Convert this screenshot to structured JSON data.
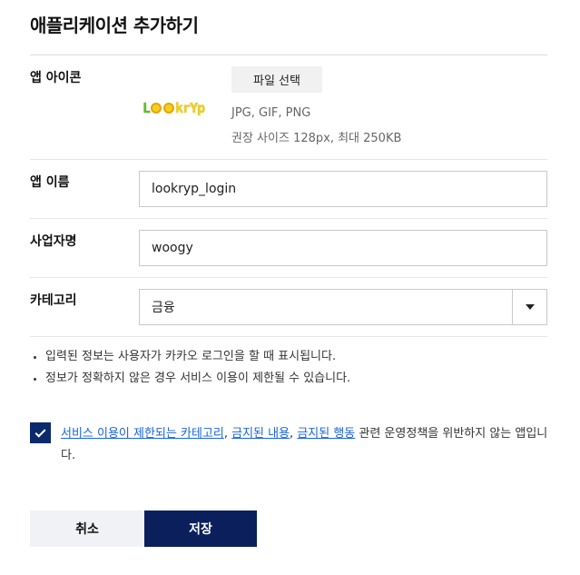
{
  "page": {
    "title": "애플리케이션 추가하기"
  },
  "icon_section": {
    "label": "앱 아이콘",
    "file_button": "파일 선택",
    "logo_text": {
      "part1": "L",
      "part2": "krYp"
    },
    "formats": "JPG, GIF, PNG",
    "size_hint": "권장 사이즈 128px, 최대 250KB"
  },
  "app_name": {
    "label": "앱 이름",
    "value": "lookryp_login"
  },
  "business": {
    "label": "사업자명",
    "value": "woogy"
  },
  "category": {
    "label": "카테고리",
    "value": "금융"
  },
  "notes": [
    "입력된 정보는 사용자가 카카오 로그인을 할 때 표시됩니다.",
    "정보가 정확하지 않은 경우 서비스 이용이 제한될 수 있습니다."
  ],
  "agreement": {
    "checked": true,
    "link1": "서비스 이용이 제한되는 카테고리",
    "sep1": ", ",
    "link2": "금지된 내용",
    "sep2": ", ",
    "link3": "금지된 행동",
    "tail": " 관련 운영정책을 위반하지 않는 앱입니다."
  },
  "buttons": {
    "cancel": "취소",
    "save": "저장"
  },
  "colors": {
    "primary": "#0a1f5c",
    "link": "#1a64e0",
    "logo_green": "#5cc21c",
    "logo_yellow": "#f2d21a"
  }
}
